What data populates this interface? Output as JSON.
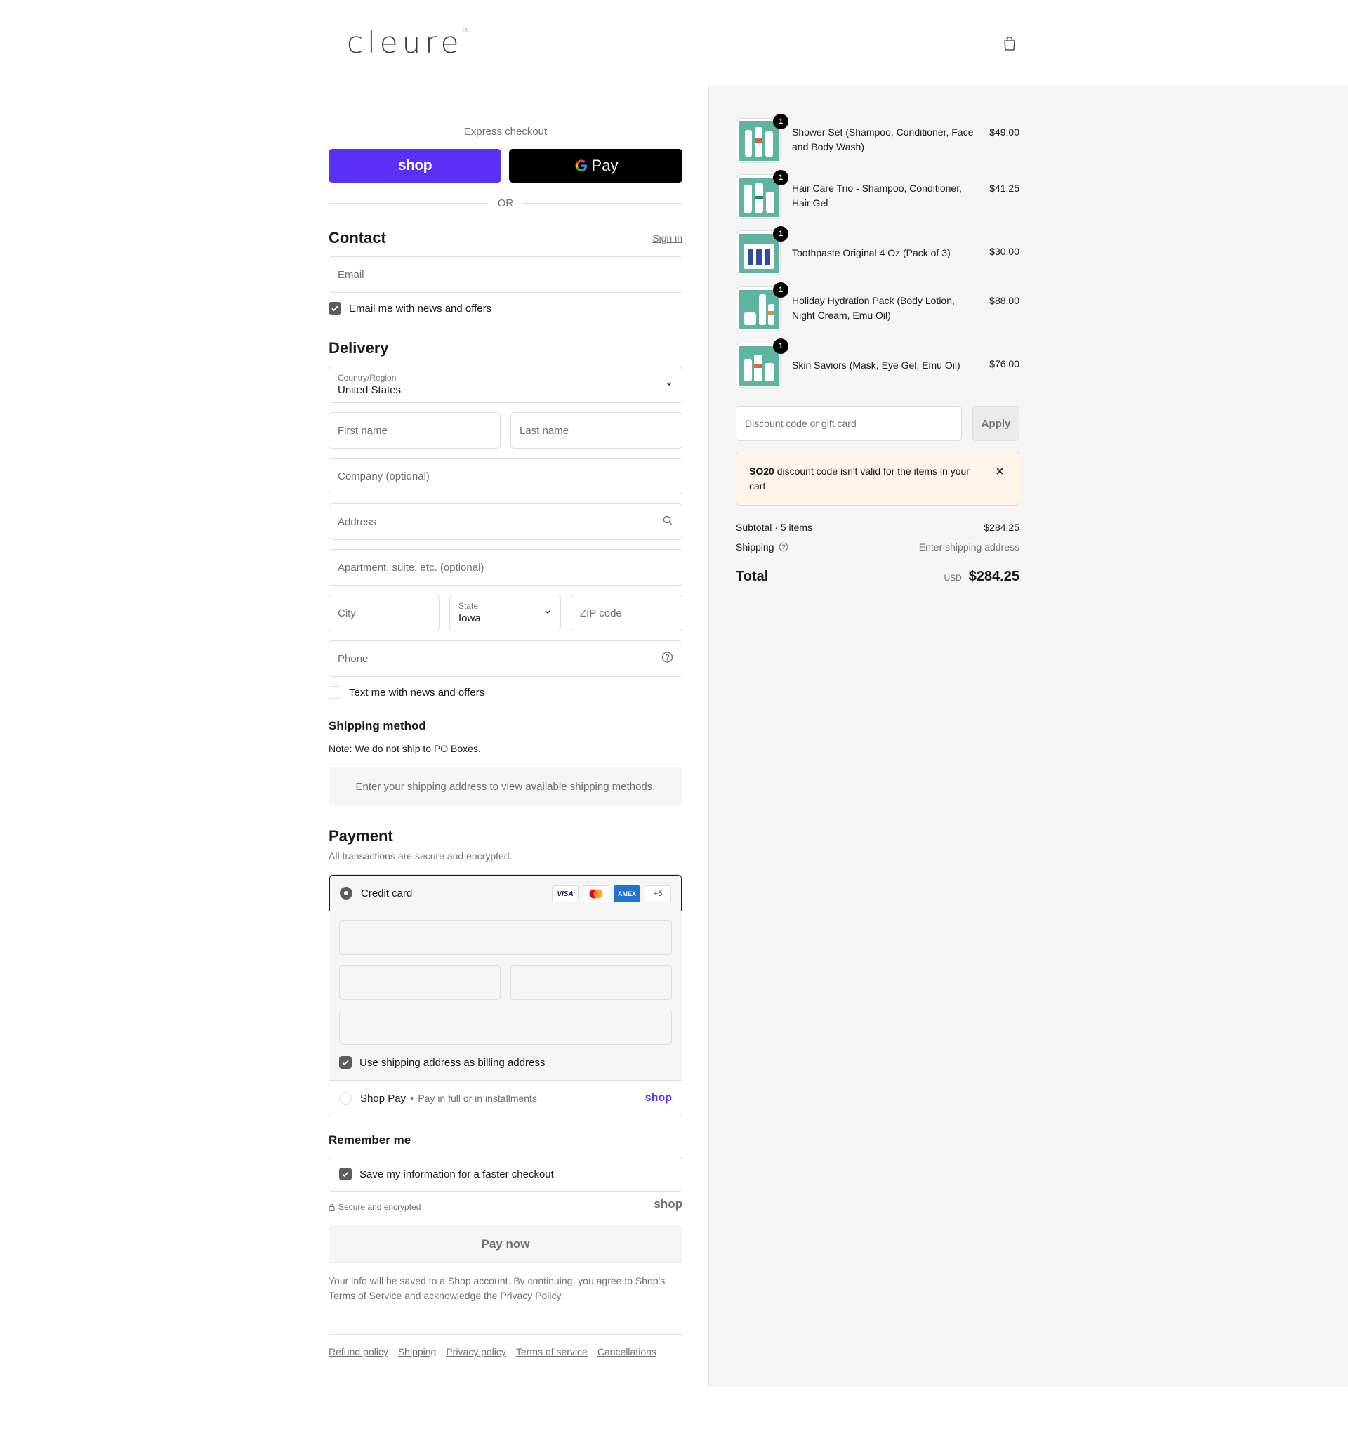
{
  "header": {
    "brand": "cleure",
    "brand_mark": "®"
  },
  "express": {
    "label": "Express checkout",
    "shop_label": "shop",
    "gpay_label": "Pay",
    "or_label": "OR"
  },
  "contact": {
    "title": "Contact",
    "sign_in": "Sign in",
    "email_placeholder": "Email",
    "newsletter_label": "Email me with news and offers",
    "newsletter_checked": true
  },
  "delivery": {
    "title": "Delivery",
    "country_label": "Country/Region",
    "country_value": "United States",
    "first_name_placeholder": "First name",
    "last_name_placeholder": "Last name",
    "company_placeholder": "Company (optional)",
    "address_placeholder": "Address",
    "apartment_placeholder": "Apartment, suite, etc. (optional)",
    "city_placeholder": "City",
    "state_label": "State",
    "state_value": "Iowa",
    "zip_placeholder": "ZIP code",
    "phone_placeholder": "Phone",
    "sms_label": "Text me with news and offers",
    "sms_checked": false
  },
  "shipping_method": {
    "title": "Shipping method",
    "note": "Note: We do not ship to PO Boxes.",
    "info": "Enter your shipping address to view available shipping methods."
  },
  "payment": {
    "title": "Payment",
    "subtitle": "All transactions are secure and encrypted.",
    "credit_card_label": "Credit card",
    "card_logos": [
      "VISA",
      "mastercard",
      "AMEX",
      "+5"
    ],
    "billing_label": "Use shipping address as billing address",
    "billing_checked": true,
    "shop_pay_label": "Shop Pay",
    "shop_pay_sub": "Pay in full or in installments",
    "shop_pay_logo": "shop"
  },
  "remember": {
    "title": "Remember me",
    "save_label": "Save my information for a faster checkout",
    "save_checked": true,
    "secure_label": "Secure and encrypted",
    "shop_logo": "shop"
  },
  "pay_now": "Pay now",
  "terms": {
    "text_1": "Your info will be saved to a Shop account. By continuing, you agree to Shop's",
    "tos_link": "Terms of Service",
    "text_2": "and acknowledge the",
    "privacy_link": "Privacy Policy",
    "text_3": "."
  },
  "footer_links": [
    "Refund policy",
    "Shipping",
    "Privacy policy",
    "Terms of service",
    "Cancellations"
  ],
  "order": {
    "items": [
      {
        "name": "Shower Set (Shampoo, Conditioner, Face and Body Wash)",
        "price": "$49.00",
        "qty": "1"
      },
      {
        "name": "Hair Care Trio - Shampoo, Conditioner, Hair Gel",
        "price": "$41.25",
        "qty": "1"
      },
      {
        "name": "Toothpaste Original 4 Oz (Pack of 3)",
        "price": "$30.00",
        "qty": "1"
      },
      {
        "name": "Holiday Hydration Pack (Body Lotion, Night Cream, Emu Oil)",
        "price": "$88.00",
        "qty": "1"
      },
      {
        "name": "Skin Saviors (Mask, Eye Gel, Emu Oil)",
        "price": "$76.00",
        "qty": "1"
      }
    ],
    "discount_placeholder": "Discount code or gift card",
    "apply_label": "Apply",
    "alert_code": "SO20",
    "alert_text": "discount code isn't valid for the items in your cart",
    "subtotal_label": "Subtotal · 5 items",
    "subtotal_value": "$284.25",
    "shipping_label": "Shipping",
    "shipping_value": "Enter shipping address",
    "total_label": "Total",
    "currency": "USD",
    "total_value": "$284.25"
  },
  "colors": {
    "shop_purple": "#5a31f4",
    "checkbox": "#5c5c5c",
    "alert_bg": "#fff5ea",
    "panel_bg": "#f5f5f5"
  }
}
